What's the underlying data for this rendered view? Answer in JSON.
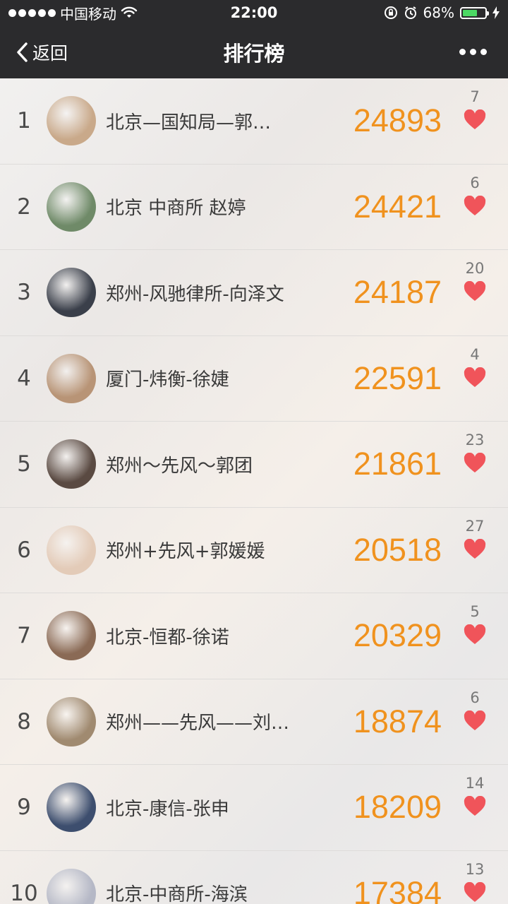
{
  "status_bar": {
    "carrier": "中国移动",
    "time": "22:00",
    "battery": "68%",
    "battery_level": 0.68
  },
  "nav": {
    "back_label": "返回",
    "title": "排行榜"
  },
  "colors": {
    "steps": "#f0921e",
    "heart": "#f0545a",
    "bar": "#2b2b2d"
  },
  "rankings": [
    {
      "rank": "1",
      "name": "北京—国知局—郭…",
      "steps": "24893",
      "likes": "7",
      "avatar": "#c9a98a"
    },
    {
      "rank": "2",
      "name": "北京 中商所 赵婷",
      "steps": "24421",
      "likes": "6",
      "avatar": "#6f8a68"
    },
    {
      "rank": "3",
      "name": "郑州-风驰律所-向泽文",
      "steps": "24187",
      "likes": "20",
      "avatar": "#3a3f4a"
    },
    {
      "rank": "4",
      "name": "厦门-炜衡-徐婕",
      "steps": "22591",
      "likes": "4",
      "avatar": "#b89476"
    },
    {
      "rank": "5",
      "name": "郑州～先风～郭团",
      "steps": "21861",
      "likes": "23",
      "avatar": "#5a4a42"
    },
    {
      "rank": "6",
      "name": "郑州+先风+郭媛媛",
      "steps": "20518",
      "likes": "27",
      "avatar": "#e3cbb8"
    },
    {
      "rank": "7",
      "name": "北京-恒都-徐诺",
      "steps": "20329",
      "likes": "5",
      "avatar": "#8a6a55"
    },
    {
      "rank": "8",
      "name": "郑州——先风——刘秀秀",
      "steps": "18874",
      "likes": "6",
      "avatar": "#a08a70"
    },
    {
      "rank": "9",
      "name": "北京-康信-张申",
      "steps": "18209",
      "likes": "14",
      "avatar": "#3d4e6e"
    },
    {
      "rank": "10",
      "name": "北京-中商所-海滨",
      "steps": "17384",
      "likes": "13",
      "avatar": "#b5b8c6"
    }
  ]
}
